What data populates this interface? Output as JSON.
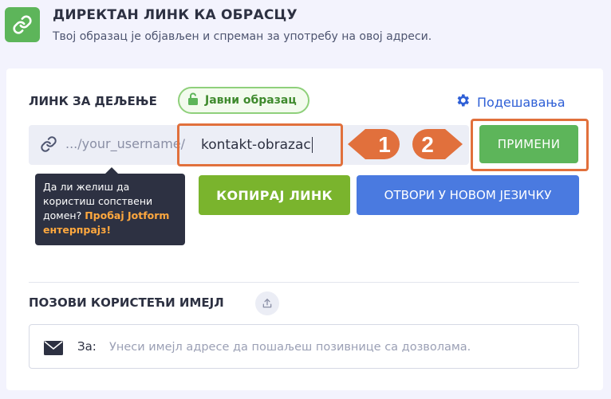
{
  "header": {
    "title": "ДИРЕКТАН ЛИНК КА ОБРАСЦУ",
    "subtitle": "Твој образац је објављен и спреман за употребу на овој адреси.",
    "icon": "link-icon"
  },
  "share": {
    "label": "ЛИНК ЗА ДЕЉЕЊЕ",
    "badge": "Јавни образац",
    "badge_icon": "unlock-icon",
    "settings": "Подешавања",
    "settings_icon": "gear-icon",
    "url_prefix": ".../your_username/",
    "url_slug": "kontakt-obrazac",
    "apply_button": "ПРИМЕНИ"
  },
  "callouts": {
    "step1": "1",
    "step2": "2",
    "color": "#e1703c"
  },
  "tooltip": {
    "text": "Да ли желиш да користиш сопствени домен?",
    "highlight": "Пробај Jotform ентерпрајз!"
  },
  "actions": {
    "copy": "КОПИРАЈ ЛИНК",
    "open": "ОТВОРИ У НОВОМ ЈЕЗИЧКУ"
  },
  "invite": {
    "label": "ПОЗОВИ КОРИСТЕЋИ ИМЕЈЛ",
    "to_label": "За:",
    "placeholder": "Унеси имејл адресе да пошаљеш позивнице са дозволама."
  },
  "colors": {
    "green": "#5db55a",
    "copy_green": "#7ab42d",
    "blue": "#4a7ae0",
    "orange": "#e1703c"
  }
}
